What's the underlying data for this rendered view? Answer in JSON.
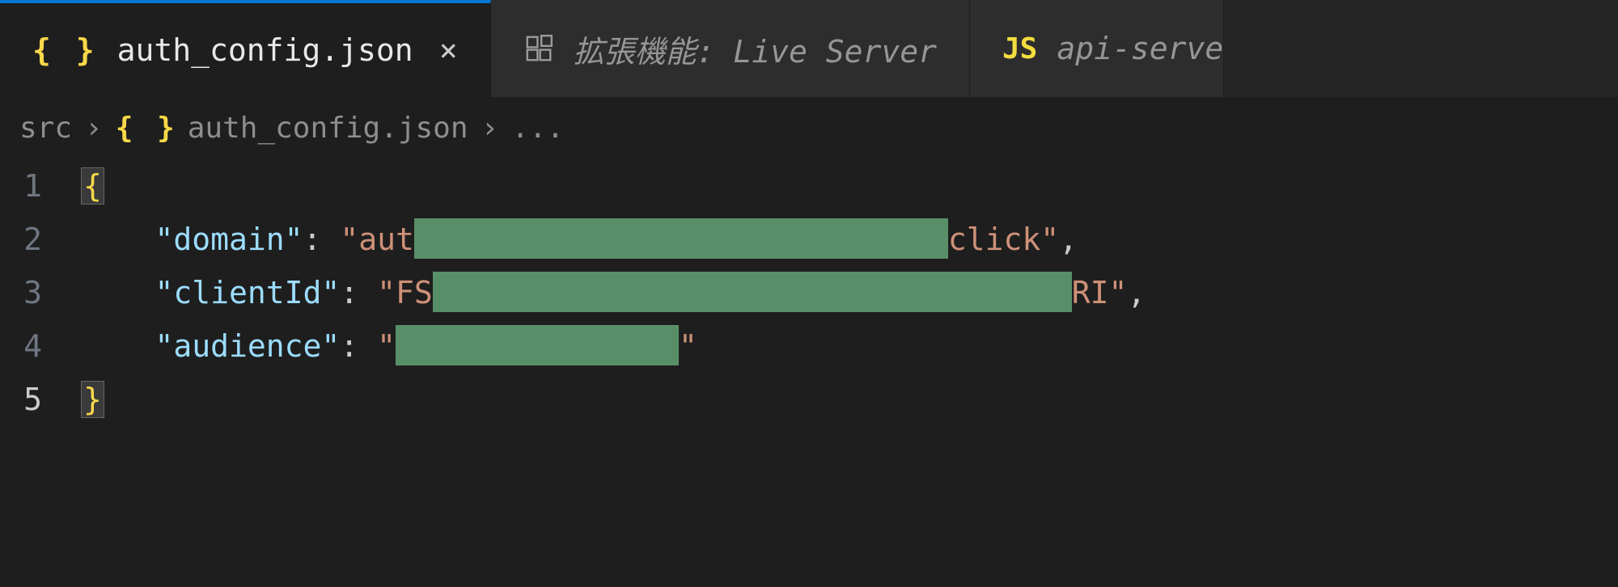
{
  "tabs": [
    {
      "icon": "json-icon",
      "label": "auth_config.json",
      "active": true,
      "closeable": true
    },
    {
      "icon": "ext-icon",
      "label": "拡張機能: Live Server",
      "active": false,
      "closeable": false
    },
    {
      "icon": "js-icon",
      "iconText": "JS",
      "label": "api-serve",
      "active": false,
      "closeable": false
    }
  ],
  "breadcrumb": {
    "root": "src",
    "file": "auth_config.json",
    "trailing": "..."
  },
  "code": {
    "lines": [
      "1",
      "2",
      "3",
      "4",
      "5"
    ],
    "json": {
      "key1": "\"domain\"",
      "val1_pre": "\"aut",
      "val1_post": "click\"",
      "key2": "\"clientId\"",
      "val2_pre": "\"FS",
      "val2_post": "RI\"",
      "key3": "\"audience\"",
      "val3_pre": "\"",
      "val3_post": "\""
    }
  },
  "iconGlyphs": {
    "jsonBraces": "{ }"
  }
}
